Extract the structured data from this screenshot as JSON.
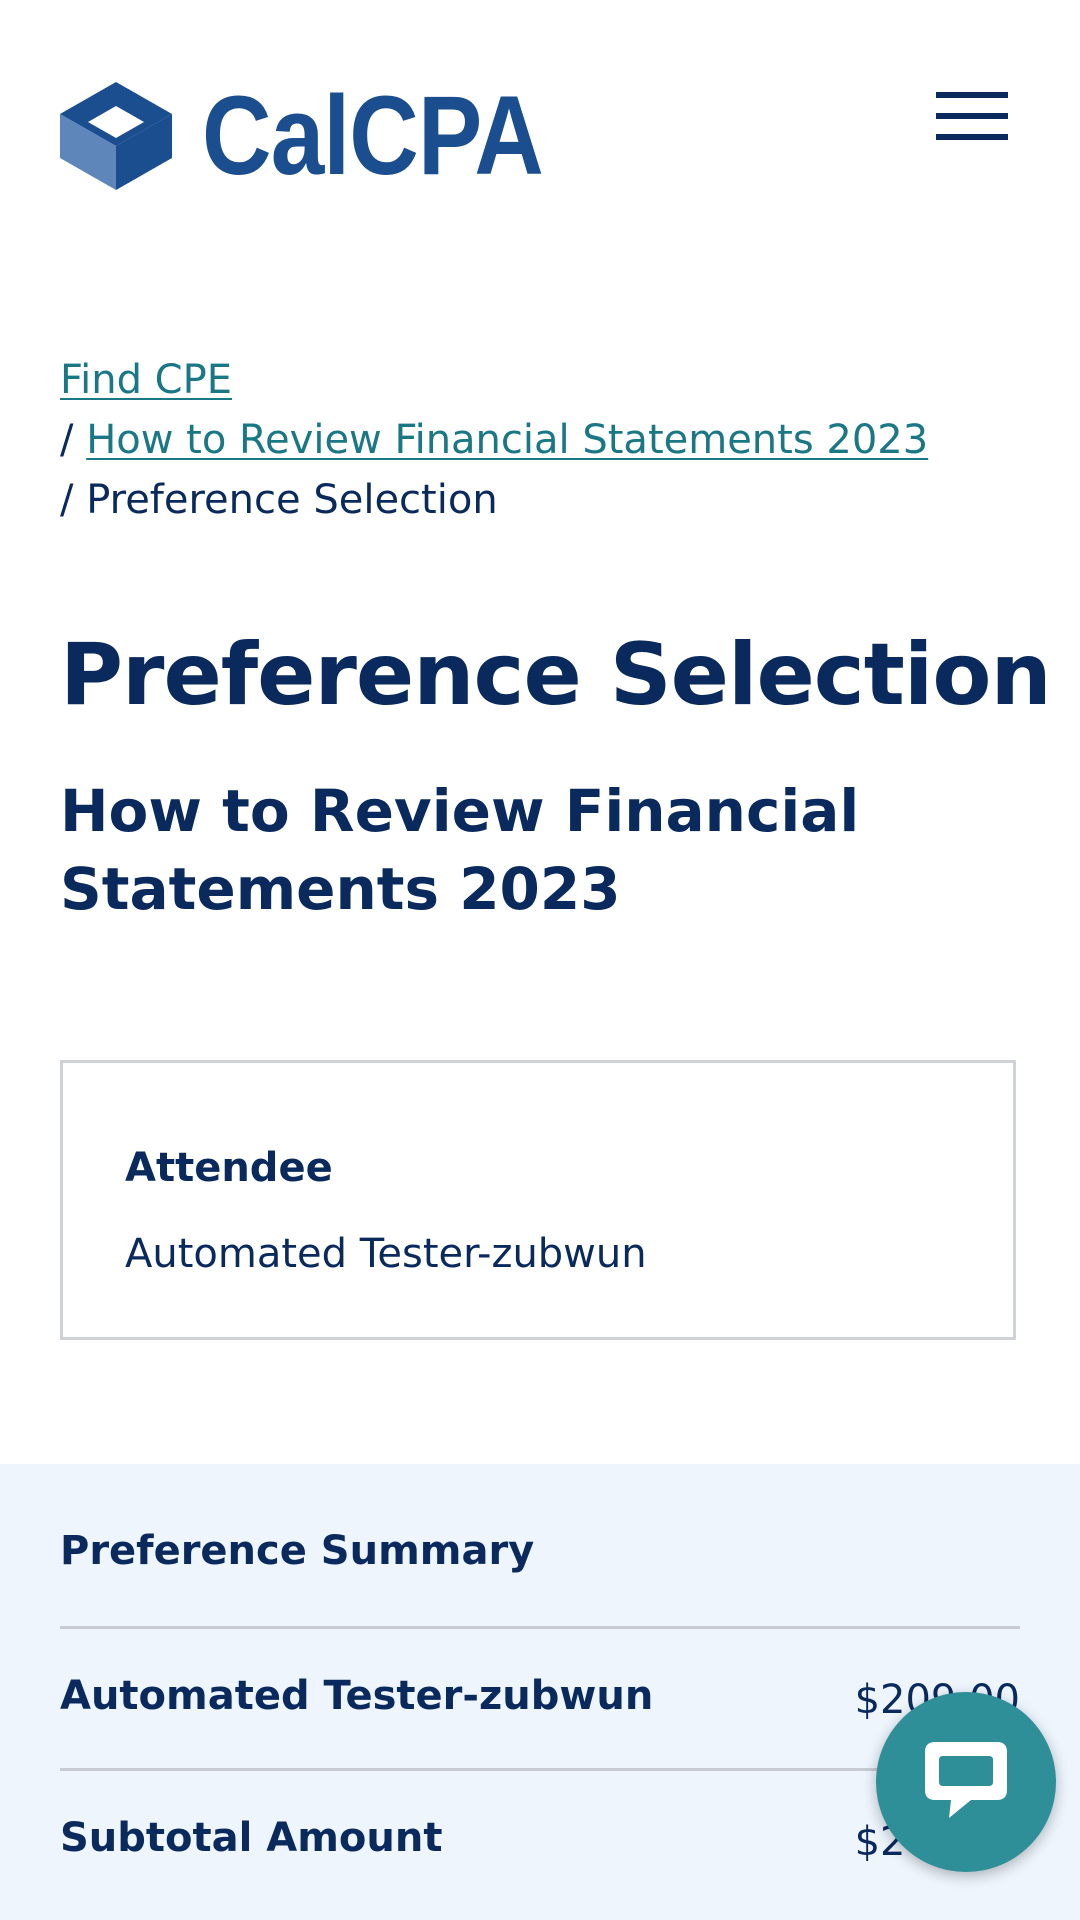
{
  "header": {
    "logo_text": "CalCPA",
    "menu_icon": "hamburger-menu-icon",
    "brand_color": "#1a4e8f"
  },
  "breadcrumb": {
    "items": [
      {
        "label": "Find CPE",
        "is_link": true
      },
      {
        "label": "How to Review Financial Statements 2023",
        "is_link": true
      },
      {
        "label": "Preference Selection",
        "is_link": false
      }
    ],
    "separator": "/"
  },
  "page": {
    "title": "Preference Selection",
    "course_title": "How to Review Financial Statements 2023"
  },
  "attendee": {
    "label": "Attendee",
    "name": "Automated Tester-zubwun"
  },
  "summary": {
    "title": "Preference Summary",
    "rows": [
      {
        "label": "Automated Tester-zubwun",
        "amount": "$209.00"
      },
      {
        "label": "Subtotal Amount",
        "amount": "$209.00"
      }
    ]
  },
  "chat": {
    "icon": "chat-bubble-icon"
  },
  "colors": {
    "navy": "#0a2a5e",
    "link_teal": "#1a7785",
    "summary_bg": "#eef5fd",
    "chat_bg": "#2f8f98"
  }
}
